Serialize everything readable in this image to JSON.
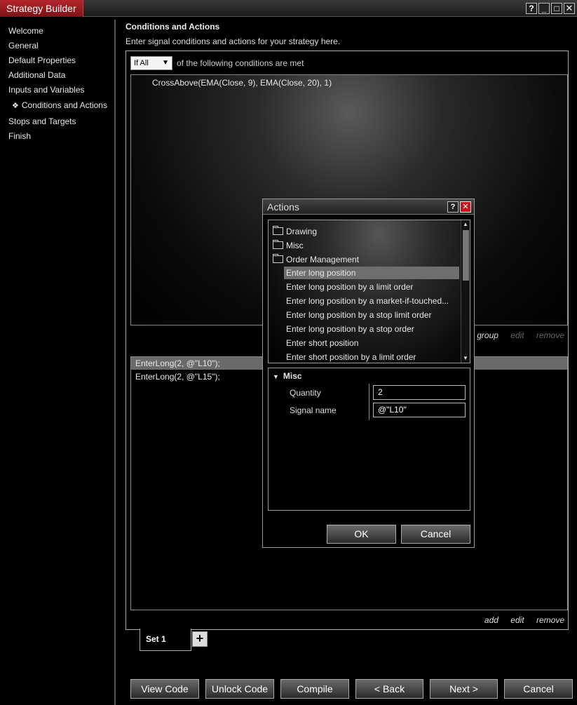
{
  "window": {
    "title": "Strategy Builder",
    "help": "?",
    "minimize": "_",
    "maximize": "□",
    "close": "✕"
  },
  "sidebar": {
    "items": [
      {
        "label": "Welcome"
      },
      {
        "label": "General"
      },
      {
        "label": "Default Properties"
      },
      {
        "label": "Additional Data"
      },
      {
        "label": "Inputs and Variables"
      },
      {
        "label": "Conditions and Actions",
        "marker": "❖"
      },
      {
        "label": "Stops and Targets"
      },
      {
        "label": "Finish"
      }
    ]
  },
  "main": {
    "title": "Conditions and Actions",
    "description": "Enter signal conditions and actions for your strategy here.",
    "condition_mode": "If All",
    "condition_mode_trail": "of the following conditions are met",
    "conditions": [
      "CrossAbove(EMA(Close, 9), EMA(Close, 20), 1)"
    ],
    "condition_links": {
      "group": "group",
      "edit": "edit",
      "remove": "remove"
    },
    "actions": [
      "EnterLong(2, @\"L10\");",
      "EnterLong(2, @\"L15\");"
    ],
    "action_links": {
      "add": "add",
      "edit": "edit",
      "remove": "remove"
    },
    "tab_label": "Set 1",
    "tab_add": "+"
  },
  "buttons": {
    "view_code": "View Code",
    "unlock_code": "Unlock Code",
    "compile": "Compile",
    "back": "< Back",
    "next": "Next >",
    "cancel": "Cancel"
  },
  "dialog": {
    "title": "Actions",
    "help": "?",
    "close": "✕",
    "folders": [
      "Drawing",
      "Misc",
      "Order Management"
    ],
    "items": [
      "Enter long position",
      "Enter long position by a limit order",
      "Enter long position by a market-if-touched...",
      "Enter long position by a stop limit order",
      "Enter long position by a stop order",
      "Enter short position",
      "Enter short position by a limit order"
    ],
    "props": {
      "group": "Misc",
      "quantity_label": "Quantity",
      "quantity_value": "2",
      "signal_label": "Signal name",
      "signal_value": "@\"L10\""
    },
    "ok": "OK",
    "cancel": "Cancel"
  }
}
